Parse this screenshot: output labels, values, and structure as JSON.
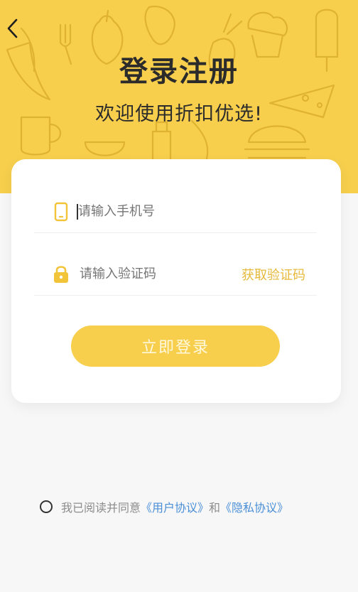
{
  "header": {
    "title": "登录注册",
    "subtitle": "欢迎使用折扣优选!"
  },
  "form": {
    "phone_placeholder": "请输入手机号",
    "code_placeholder": "请输入验证码",
    "get_code_label": "获取验证码",
    "submit_label": "立即登录"
  },
  "agreement": {
    "prefix": "我已阅读并同意",
    "user_link": "《用户协议》",
    "connector": "和",
    "privacy_link": "《隐私协议》"
  },
  "colors": {
    "brand_yellow": "#f7cf4d",
    "accent_text": "#e6b93c",
    "link_blue": "#4a8fd6",
    "page_bg": "#f7f7f8"
  },
  "icons": [
    "back-arrow-icon",
    "phone-icon",
    "lock-icon",
    "radio-unchecked-icon"
  ]
}
